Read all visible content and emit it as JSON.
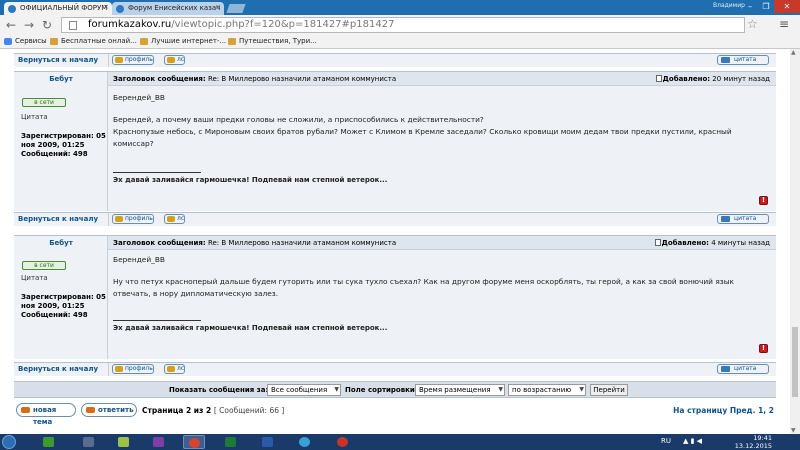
{
  "browser": {
    "tabs": [
      {
        "label": "ОФИЦИАЛЬНЫЙ ФОРУМ"
      },
      {
        "label": "Форум Енисейских казач"
      }
    ],
    "user_label": "Владимир",
    "url": {
      "host": "forumkazakov.ru",
      "path": "/viewtopic.php?f=120&p=181427#p181427"
    },
    "bookmarks": [
      "Сервисы",
      "Бесплатные онлай...",
      "Лучшие интернет-...",
      "Путешествия, Тури..."
    ]
  },
  "forum": {
    "back_label": "Вернуться к началу",
    "profile_label": "профиль",
    "pm_label": "лс",
    "quote_label": "цитата",
    "subject_label": "Заголовок сообщения:",
    "added_label": "Добавлено:",
    "posts": [
      {
        "author": "Бебут",
        "status": "в сети",
        "quote_label": "Цитата",
        "registered": "Зарегистрирован: 05",
        "registered_date": "ноя 2009, 01:25",
        "messages": "Сообщений: 498",
        "subject": "Re: В Миллерово назначили атаманом коммуниста",
        "time": "20 минут назад",
        "lines": [
          "Берендей_ВВ",
          "Берендей, а почему ваши предки головы не сложили, а приспособились к действительности?",
          "Краснопузые небось, с Мироновым своих братов рубали? Может с Климом в Кремле заседали? Сколько кровищи моим дедам твои предки пустили, красный",
          "комиссар?"
        ],
        "signature": "Эх давай заливайся гармошечка! Подпевай нам степной ветерок..."
      },
      {
        "author": "Бебут",
        "status": "в сети",
        "quote_label": "Цитата",
        "registered": "Зарегистрирован: 05",
        "registered_date": "ноя 2009, 01:25",
        "messages": "Сообщений: 498",
        "subject": "Re: В Миллерово назначили атаманом коммуниста",
        "time": "4 минуты назад",
        "lines": [
          "Берендей_ВВ",
          "Ну что петух красноперый дальше будем гуторить или ты сука тухло съехал? Как на другом форуме меня оскорблять, ты герой, а как за свой вонючий язык",
          "отвечать, в нору дипломатическую залез."
        ],
        "signature": "Эх давай заливайся гармошечка! Подпевай нам степной ветерок..."
      }
    ],
    "sorting": {
      "show_label": "Показать сообщения за:",
      "show_value": "Все сообщения",
      "sort_label": "Поле сортировки",
      "sort_value": "Время размещения",
      "order_value": "по возрастанию",
      "go_label": "Перейти"
    },
    "pagination": {
      "new_topic": "новая тема",
      "reply": "ответить",
      "page_info": "Страница 2 из 2",
      "count_info": "[ Сообщений: 66 ]",
      "nav_prefix": "На страницу Пред.",
      "pages": "1, 2"
    }
  },
  "taskbar": {
    "lang": "RU",
    "time": "19:41",
    "date": "13.12.2015"
  }
}
